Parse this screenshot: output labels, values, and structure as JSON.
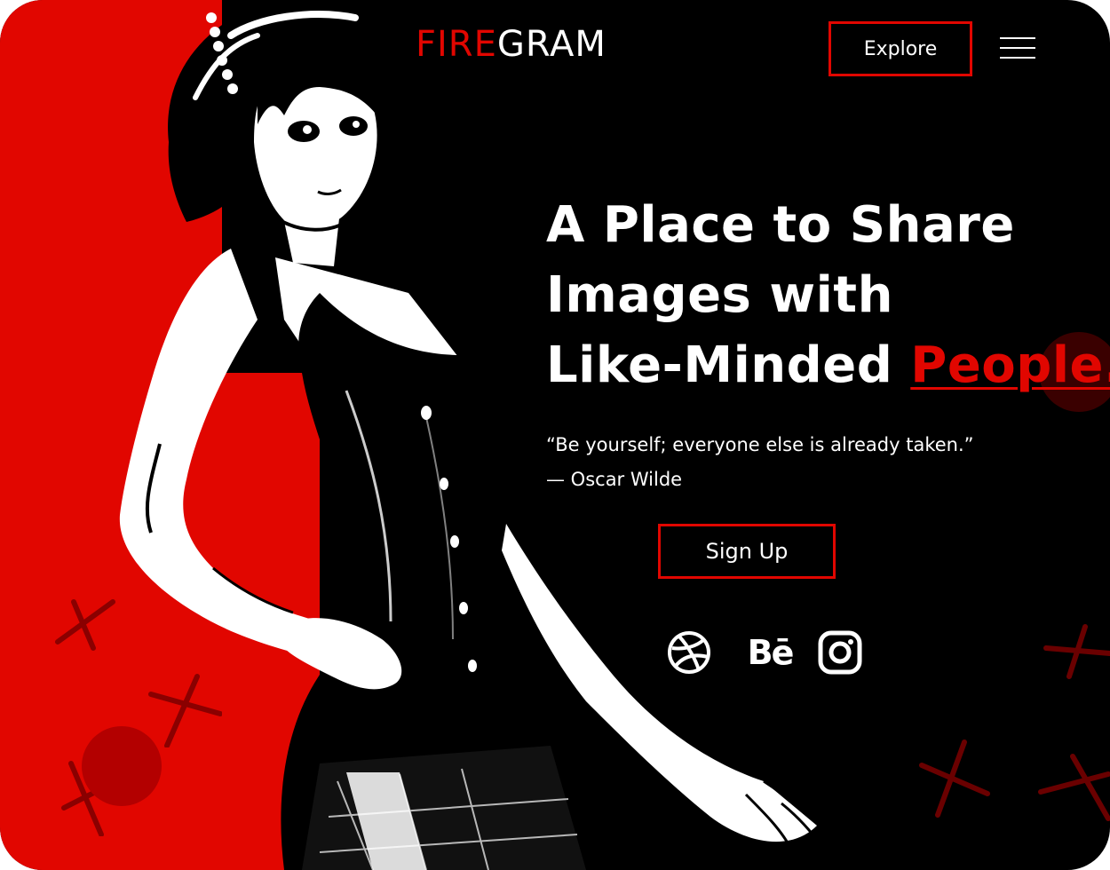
{
  "brand": {
    "logo_part1": "FIRE",
    "logo_part2": "GRAM",
    "accent_color": "#e10600",
    "background_color": "#000000",
    "text_color": "#ffffff"
  },
  "nav": {
    "explore_label": "Explore",
    "menu_icon": "hamburger-menu-icon"
  },
  "hero": {
    "headline_line1": "A Place to Share",
    "headline_line2": "Images with",
    "headline_line3_prefix": "Like-Minded ",
    "headline_accent": "People.",
    "quote_text": "“Be yourself; everyone else is already taken.”",
    "quote_author": "— Oscar Wilde",
    "signup_label": "Sign Up"
  },
  "social": [
    {
      "name": "dribbble",
      "icon": "dribbble-icon"
    },
    {
      "name": "behance",
      "icon": "behance-icon",
      "label": "Bē"
    },
    {
      "name": "instagram",
      "icon": "instagram-icon"
    }
  ]
}
